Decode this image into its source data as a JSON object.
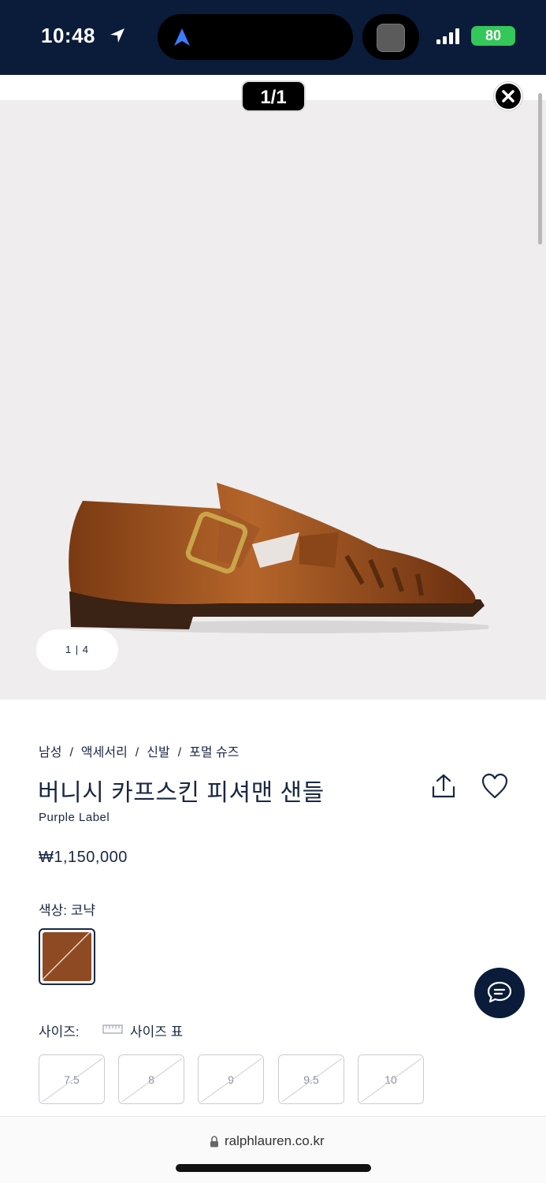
{
  "status_bar": {
    "time": "10:48",
    "battery": "80",
    "icons": [
      "location-arrow-icon",
      "navigation-icon",
      "app-thumbnail-icon",
      "signal-icon",
      "battery-icon"
    ]
  },
  "viewer": {
    "page_indicator": "1/1",
    "close_icon": "close-icon"
  },
  "gallery": {
    "counter": "1 | 4"
  },
  "product": {
    "breadcrumb": [
      "남성",
      "액세서리",
      "신발",
      "포멀 슈즈"
    ],
    "breadcrumb_separator": "/",
    "title": "버니시 카프스킨 피셔맨 샌들",
    "sub_brand": "Purple Label",
    "price": "₩1,150,000",
    "color_label": "색상: 코냑",
    "swatch_color": "#8e4a22",
    "size_label": "사이즈:",
    "size_chart_label": "사이즈 표",
    "sizes": [
      "7.5",
      "8",
      "9",
      "9.5",
      "10"
    ]
  },
  "browser": {
    "url": "ralphlauren.co.kr"
  },
  "colors": {
    "navy": "#0b1b3a",
    "photo_bg": "#efedee",
    "text": "#1a2744"
  }
}
